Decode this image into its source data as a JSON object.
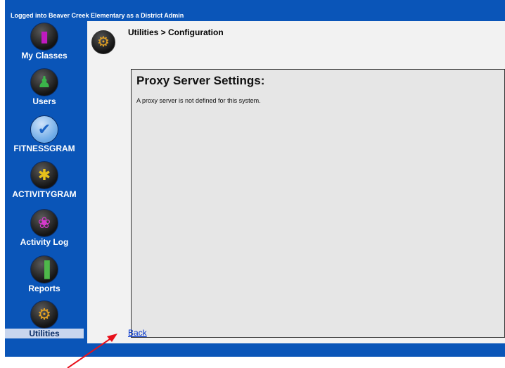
{
  "header": {
    "banner_text": "Logged into Beaver Creek Elementary as a District Admin"
  },
  "sidebar": {
    "items": [
      {
        "label": "My Classes",
        "icon": "phone-icon",
        "glyph": "▮",
        "color": "#c01ac0"
      },
      {
        "label": "Users",
        "icon": "user-icon",
        "glyph": "♟",
        "color": "#3bb54a"
      },
      {
        "label": "FITNESSGRAM",
        "icon": "checkmark-icon",
        "glyph": "✔",
        "color": "#6aa8e6"
      },
      {
        "label": "ACTIVITYGRAM",
        "icon": "activity-person-icon",
        "glyph": "✱",
        "color": "#e8c11a"
      },
      {
        "label": "Activity Log",
        "icon": "running-person-icon",
        "glyph": "❀",
        "color": "#d53acb"
      },
      {
        "label": "Reports",
        "icon": "bar-chart-icon",
        "glyph": "▐",
        "color": "#4eb84a"
      },
      {
        "label": "Utilities",
        "icon": "gears-icon",
        "glyph": "⚙",
        "color": "#e3a123"
      }
    ]
  },
  "main": {
    "breadcrumb": "Utilities > Configuration",
    "page_icon": "gears-icon",
    "panel": {
      "title": "Proxy Server Settings:",
      "message": "A proxy server is not defined for this system."
    },
    "back_link": "Back"
  },
  "colors": {
    "app_blue": "#0a55b8",
    "content_bg": "#f2f2f2",
    "panel_bg": "#e6e6e6",
    "link": "#0033cc",
    "annotation_arrow": "#e8101a"
  }
}
